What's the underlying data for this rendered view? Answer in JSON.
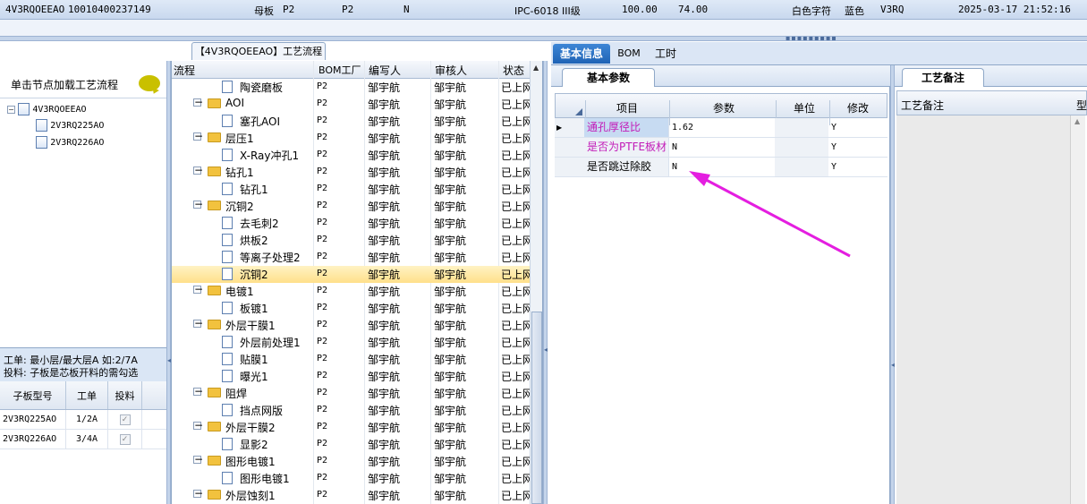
{
  "topbar": {
    "fields": [
      "4V3RQOEEAO",
      "10010400237149",
      "母板",
      "P2",
      "P2",
      "N",
      "IPC-6018 III级",
      "100.00",
      "74.00",
      "白色字符",
      "蓝色",
      "V3RQ",
      "2025-03-17 21:52:16"
    ]
  },
  "left": {
    "load_hint": "单击节点加载工艺流程",
    "tree": {
      "root": "4V3RQOEEAO",
      "children": [
        "2V3RQ225AO",
        "2V3RQ226AO"
      ]
    },
    "note_line1": "工单: 最小层/最大层A 如:2/7A",
    "note_line2": "投料: 子板是芯板开料的需勾选",
    "grid": {
      "headers": [
        "子板型号",
        "工单",
        "投料"
      ],
      "rows": [
        {
          "model": "2V3RQ225AO",
          "order": "1/2A",
          "feed": "✓"
        },
        {
          "model": "2V3RQ226AO",
          "order": "3/4A",
          "feed": "✓"
        }
      ]
    }
  },
  "middle": {
    "tab_label": "【4V3RQOEEAO】工艺流程",
    "headers": [
      "流程",
      "BOM工厂",
      "编写人",
      "审核人",
      "状态"
    ],
    "rows": [
      {
        "name": "陶瓷磨板",
        "level": 1,
        "bom": "P2",
        "writer": "邹宇航",
        "reviewer": "邹宇航",
        "status": "已上网"
      },
      {
        "name": "AOI",
        "level": 0,
        "bom": "P2",
        "writer": "邹宇航",
        "reviewer": "邹宇航",
        "status": "已上网"
      },
      {
        "name": "塞孔AOI",
        "level": 1,
        "bom": "P2",
        "writer": "邹宇航",
        "reviewer": "邹宇航",
        "status": "已上网"
      },
      {
        "name": "层压1",
        "level": 0,
        "bom": "P2",
        "writer": "邹宇航",
        "reviewer": "邹宇航",
        "status": "已上网"
      },
      {
        "name": "X-Ray冲孔1",
        "level": 1,
        "bom": "P2",
        "writer": "邹宇航",
        "reviewer": "邹宇航",
        "status": "已上网"
      },
      {
        "name": "钻孔1",
        "level": 0,
        "bom": "P2",
        "writer": "邹宇航",
        "reviewer": "邹宇航",
        "status": "已上网"
      },
      {
        "name": "钻孔1",
        "level": 1,
        "bom": "P2",
        "writer": "邹宇航",
        "reviewer": "邹宇航",
        "status": "已上网"
      },
      {
        "name": "沉铜2",
        "level": 0,
        "bom": "P2",
        "writer": "邹宇航",
        "reviewer": "邹宇航",
        "status": "已上网"
      },
      {
        "name": "去毛刺2",
        "level": 1,
        "bom": "P2",
        "writer": "邹宇航",
        "reviewer": "邹宇航",
        "status": "已上网"
      },
      {
        "name": "烘板2",
        "level": 1,
        "bom": "P2",
        "writer": "邹宇航",
        "reviewer": "邹宇航",
        "status": "已上网"
      },
      {
        "name": "等离子处理2",
        "level": 1,
        "bom": "P2",
        "writer": "邹宇航",
        "reviewer": "邹宇航",
        "status": "已上网"
      },
      {
        "name": "沉铜2",
        "level": 1,
        "bom": "P2",
        "writer": "邹宇航",
        "reviewer": "邹宇航",
        "status": "已上网",
        "selected": true
      },
      {
        "name": "电镀1",
        "level": 0,
        "bom": "P2",
        "writer": "邹宇航",
        "reviewer": "邹宇航",
        "status": "已上网"
      },
      {
        "name": "板镀1",
        "level": 1,
        "bom": "P2",
        "writer": "邹宇航",
        "reviewer": "邹宇航",
        "status": "已上网"
      },
      {
        "name": "外层干膜1",
        "level": 0,
        "bom": "P2",
        "writer": "邹宇航",
        "reviewer": "邹宇航",
        "status": "已上网"
      },
      {
        "name": "外层前处理1",
        "level": 1,
        "bom": "P2",
        "writer": "邹宇航",
        "reviewer": "邹宇航",
        "status": "已上网"
      },
      {
        "name": "贴膜1",
        "level": 1,
        "bom": "P2",
        "writer": "邹宇航",
        "reviewer": "邹宇航",
        "status": "已上网"
      },
      {
        "name": "曝光1",
        "level": 1,
        "bom": "P2",
        "writer": "邹宇航",
        "reviewer": "邹宇航",
        "status": "已上网"
      },
      {
        "name": "阻焊",
        "level": 0,
        "bom": "P2",
        "writer": "邹宇航",
        "reviewer": "邹宇航",
        "status": "已上网"
      },
      {
        "name": "挡点网版",
        "level": 1,
        "bom": "P2",
        "writer": "邹宇航",
        "reviewer": "邹宇航",
        "status": "已上网"
      },
      {
        "name": "外层干膜2",
        "level": 0,
        "bom": "P2",
        "writer": "邹宇航",
        "reviewer": "邹宇航",
        "status": "已上网"
      },
      {
        "name": "显影2",
        "level": 1,
        "bom": "P2",
        "writer": "邹宇航",
        "reviewer": "邹宇航",
        "status": "已上网"
      },
      {
        "name": "图形电镀1",
        "level": 0,
        "bom": "P2",
        "writer": "邹宇航",
        "reviewer": "邹宇航",
        "status": "已上网"
      },
      {
        "name": "图形电镀1",
        "level": 1,
        "bom": "P2",
        "writer": "邹宇航",
        "reviewer": "邹宇航",
        "status": "已上网"
      },
      {
        "name": "外层蚀刻1",
        "level": 0,
        "bom": "P2",
        "writer": "邹宇航",
        "reviewer": "邹宇航",
        "status": "已上网"
      }
    ]
  },
  "right": {
    "tabs": [
      "基本信息",
      "BOM",
      "工时"
    ],
    "active_tab": "基本信息",
    "param_tab": "基本参数",
    "param_headers": [
      "项目",
      "参数",
      "单位",
      "修改"
    ],
    "params": [
      {
        "item": "通孔厚径比",
        "value": "1.62",
        "unit": "",
        "modify": "Y",
        "item_color": "#c21bb8",
        "item_bg": "#c7dbf2",
        "current": true
      },
      {
        "item": "是否为PTFE板材",
        "value": "N",
        "unit": "",
        "modify": "Y",
        "item_color": "#c21bb8",
        "item_bg": "#eef2f7"
      },
      {
        "item": "是否跳过除胶",
        "value": "N",
        "unit": "",
        "modify": "Y",
        "item_color": "#000000",
        "item_bg": "#eef2f7"
      }
    ],
    "notes_tab": "工艺备注",
    "notes_header": "工艺备注",
    "notes_header2": "型"
  },
  "colors": {
    "annotation_arrow": "#e41ee0",
    "selection": "#ffe08a",
    "tab_active": "#2a6fc4"
  }
}
